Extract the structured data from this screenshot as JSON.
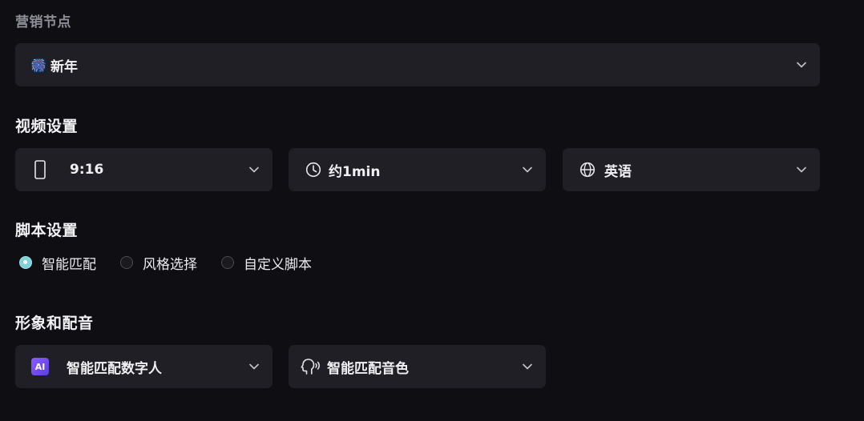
{
  "marketing": {
    "title": "营销节点",
    "selected_emoji": "🎆",
    "selected": "新年"
  },
  "video": {
    "title": "视频设置",
    "ratio": "9:16",
    "duration": "约1min",
    "language": "英语"
  },
  "script": {
    "title": "脚本设置",
    "options": [
      {
        "label": "智能匹配",
        "selected": true
      },
      {
        "label": "风格选择",
        "selected": false
      },
      {
        "label": "自定义脚本",
        "selected": false
      }
    ]
  },
  "avatar": {
    "title": "形象和配音",
    "ai_badge": "AI",
    "digital_human": "智能匹配数字人",
    "voice": "智能匹配音色"
  },
  "icons": {
    "ratio": "phone-portrait-icon",
    "duration": "clock-icon",
    "language": "globe-icon",
    "voice": "speaking-head-icon",
    "chevron": "chevron-down-icon"
  },
  "colors": {
    "background": "#0f0f13",
    "field": "#1f1f25",
    "radio_active": "#7fd3d8",
    "ai_badge": "#6f48f0"
  }
}
